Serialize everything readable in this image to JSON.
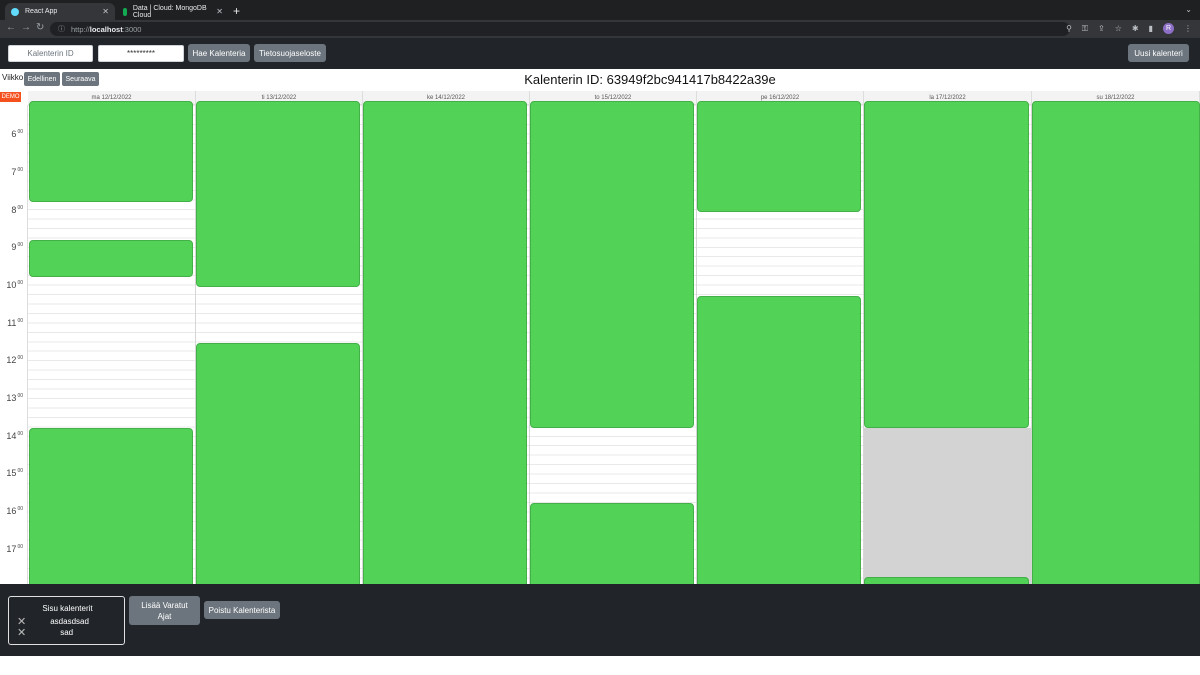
{
  "browser": {
    "tabs": [
      {
        "title": "React App",
        "active": true
      },
      {
        "title": "Data | Cloud: MongoDB Cloud",
        "active": false
      }
    ],
    "url_host": "localhost",
    "url_prefix": "http://",
    "url_port": ":3000",
    "profile_initial": "R"
  },
  "header": {
    "id_placeholder": "Kalenterin ID",
    "password_value": "*********",
    "fetch_button": "Hae Kalenteria",
    "privacy_button": "Tietosuojaseloste",
    "new_calendar_button": "Uusi kalenteri"
  },
  "week": {
    "label": "Viikko",
    "prev_button": "Edellinen",
    "next_button": "Seuraava"
  },
  "calendar": {
    "title": "Kalenterin ID: 63949f2bc941417b8422a39e",
    "demo_badge": "DEMO",
    "days": [
      "ma 12/12/2022",
      "ti 13/12/2022",
      "ke 14/12/2022",
      "to 15/12/2022",
      "pe 16/12/2022",
      "la 17/12/2022",
      "su 18/12/2022"
    ],
    "hours": [
      "6",
      "7",
      "8",
      "9",
      "10",
      "11",
      "12",
      "13",
      "14",
      "15",
      "16",
      "17"
    ],
    "hour_suffix": "00",
    "event_color": "#4cd150"
  },
  "footer": {
    "box_title": "Sisu kalenterit",
    "calendars": [
      "asdasdsad",
      "sad"
    ],
    "add_booked_button": "Lisää Varatut Ajat",
    "leave_button": "Poistu Kalenterista"
  }
}
